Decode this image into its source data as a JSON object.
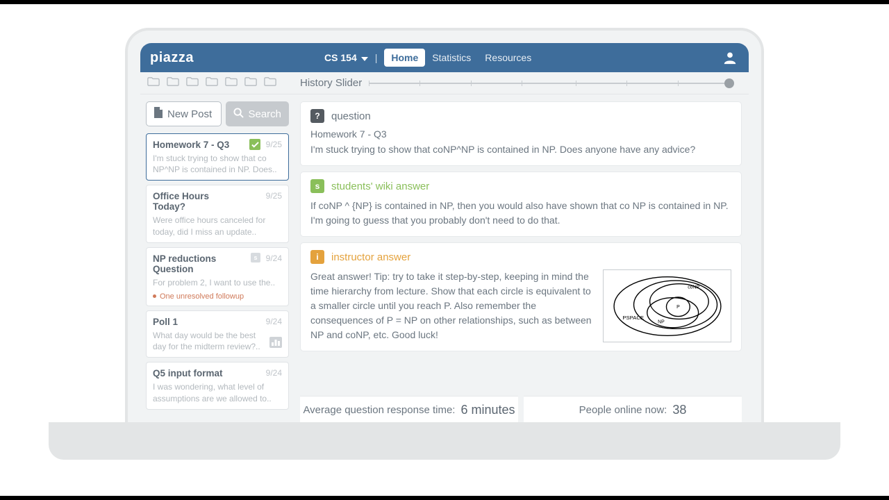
{
  "header": {
    "logo": "piazza",
    "course": "CS 154",
    "nav": {
      "home": "Home",
      "stats": "Statistics",
      "resources": "Resources"
    }
  },
  "toolbar": {
    "history_label": "History Slider"
  },
  "sidebar": {
    "new_post": "New Post",
    "search": "Search",
    "posts": [
      {
        "title": "Homework 7 - Q3",
        "date": "9/25",
        "snippet": "I'm stuck trying to show that co NP^NP is contained in NP.  Does..",
        "checked": true
      },
      {
        "title": "Office Hours Today?",
        "date": "9/25",
        "snippet": "Were office hours canceled for today, did I miss an update.."
      },
      {
        "title": "NP reductions Question",
        "date": "9/24",
        "snippet": "For problem 2, I want to use the..",
        "s_badge": true,
        "followup": "One unresolved followup"
      },
      {
        "title": "Poll 1",
        "date": "9/24",
        "snippet": "What day would be the best day for the midterm review?..",
        "poll": true
      },
      {
        "title": "Q5 input format",
        "date": "9/24",
        "snippet": "I was wondering, what level of assumptions are we allowed to.."
      }
    ]
  },
  "question": {
    "label": "question",
    "title": "Homework 7 - Q3",
    "body": "I'm stuck trying to show that coNP^NP is contained in NP.  Does anyone have any advice?"
  },
  "student_answer": {
    "label": "students' wiki answer",
    "body": "If coNP ^ {NP} is contained in NP, then you would also have shown that co NP is contained in NP. I'm going to guess that you probably don't need to do that."
  },
  "instructor_answer": {
    "label": "instructor answer",
    "body": "Great answer! Tip: try to take it step-by-step, keeping in mind the time hierarchy from lecture. Show that each circle is equivalent to a smaller circle until you reach P.  Also remember the consequences of P = NP on other relationships, such as between NP and coNP, etc. Good luck!",
    "diagram": {
      "outer": "PSPACE",
      "conp": "coNP",
      "np": "NP",
      "p": "P"
    }
  },
  "stats": {
    "resp_label": "Average question response time:",
    "resp_value": "6 minutes",
    "online_label": "People online now:",
    "online_value": "38"
  }
}
